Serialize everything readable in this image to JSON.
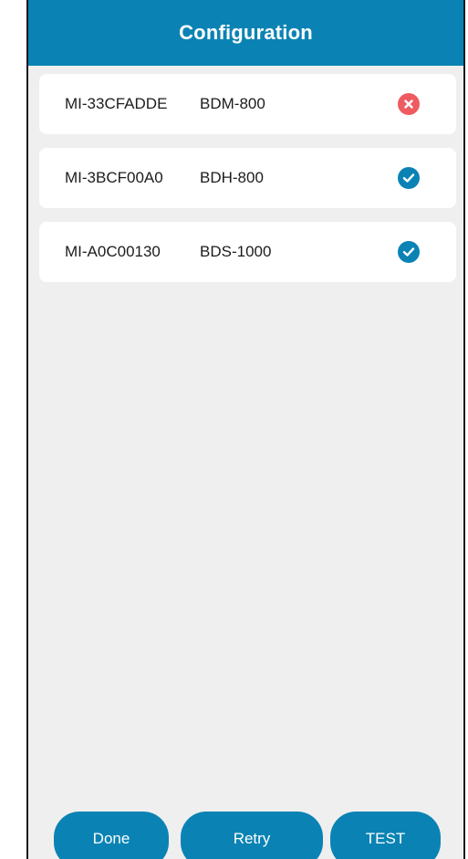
{
  "header": {
    "title": "Configuration"
  },
  "devices": [
    {
      "id": "MI-33CFADDE",
      "model": "BDM-800",
      "status": "error",
      "status_icon": "error-x-icon"
    },
    {
      "id": "MI-3BCF00A0",
      "model": "BDH-800",
      "status": "ok",
      "status_icon": "check-icon"
    },
    {
      "id": "MI-A0C00130",
      "model": "BDS-1000",
      "status": "ok",
      "status_icon": "check-icon"
    }
  ],
  "footer": {
    "done_label": "Done",
    "retry_label": "Retry",
    "test_label": "TEST"
  },
  "colors": {
    "accent": "#0a83b4",
    "error": "#ee5b60",
    "background": "#efefef",
    "card": "#ffffff"
  }
}
